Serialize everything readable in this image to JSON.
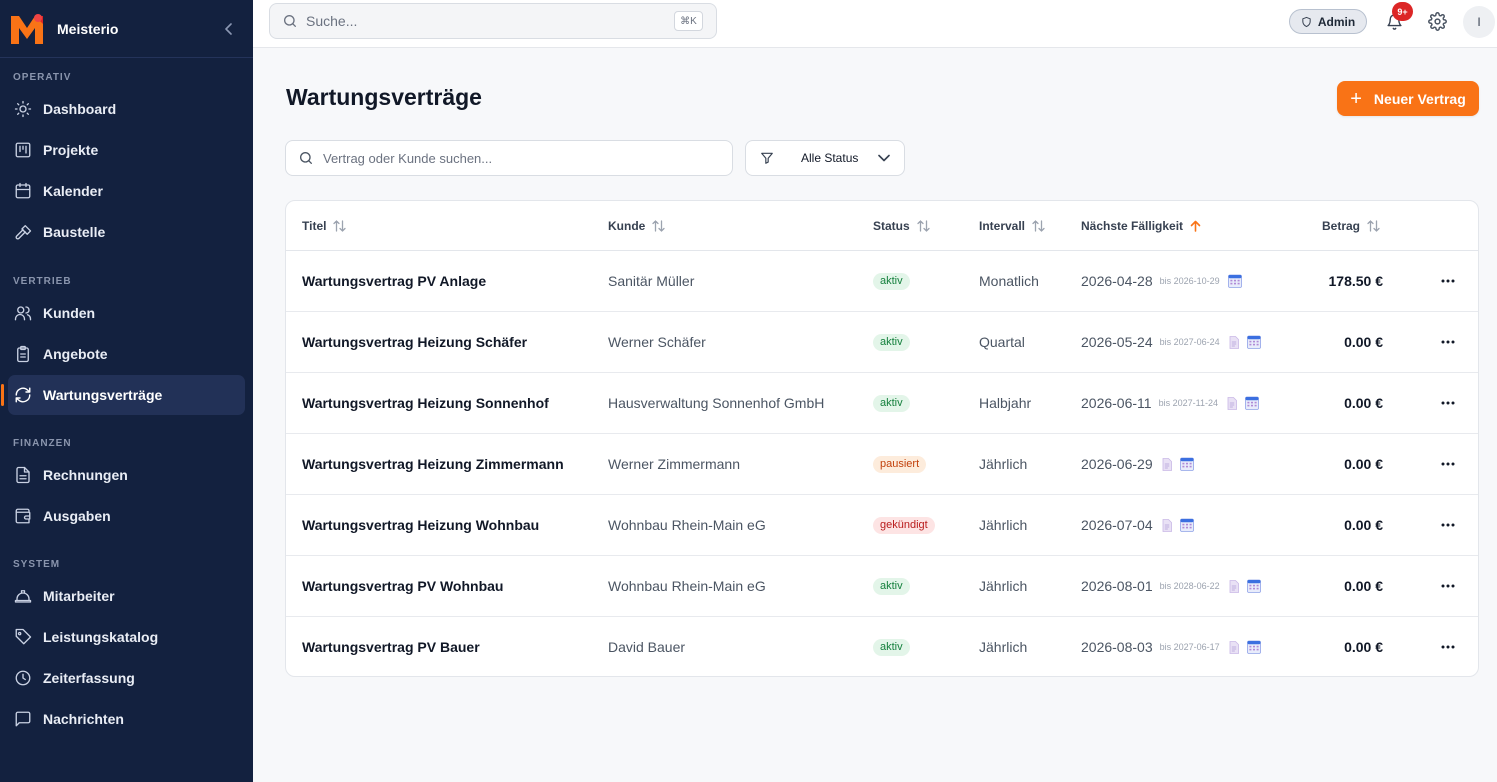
{
  "app": {
    "name": "Meisterio"
  },
  "sidebar": {
    "sections": [
      {
        "label": "OPERATIV",
        "items": [
          {
            "label": "Dashboard",
            "icon": "sun-icon"
          },
          {
            "label": "Projekte",
            "icon": "kanban-icon"
          },
          {
            "label": "Kalender",
            "icon": "calendar-icon"
          },
          {
            "label": "Baustelle",
            "icon": "hammer-icon"
          }
        ]
      },
      {
        "label": "VERTRIEB",
        "items": [
          {
            "label": "Kunden",
            "icon": "users-icon"
          },
          {
            "label": "Angebote",
            "icon": "clipboard-icon"
          },
          {
            "label": "Wartungsverträge",
            "icon": "refresh-icon",
            "active": true
          }
        ]
      },
      {
        "label": "FINANZEN",
        "items": [
          {
            "label": "Rechnungen",
            "icon": "file-text-icon"
          },
          {
            "label": "Ausgaben",
            "icon": "wallet-icon"
          }
        ]
      },
      {
        "label": "SYSTEM",
        "items": [
          {
            "label": "Mitarbeiter",
            "icon": "hardhat-icon"
          },
          {
            "label": "Leistungskatalog",
            "icon": "tag-icon"
          },
          {
            "label": "Zeiterfassung",
            "icon": "clock-icon"
          },
          {
            "label": "Nachrichten",
            "icon": "message-icon"
          }
        ]
      }
    ]
  },
  "topbar": {
    "search_placeholder": "Suche...",
    "shortcut": "⌘K",
    "role": "Admin",
    "notification_count": "9+",
    "avatar_initial": "I"
  },
  "page": {
    "title": "Wartungsverträge",
    "new_button": "Neuer Vertrag",
    "search_placeholder": "Vertrag oder Kunde suchen...",
    "status_filter": "Alle Status"
  },
  "table": {
    "columns": [
      {
        "label": "Titel"
      },
      {
        "label": "Kunde"
      },
      {
        "label": "Status"
      },
      {
        "label": "Intervall"
      },
      {
        "label": "Nächste Fälligkeit",
        "sorted": true
      },
      {
        "label": "Betrag"
      }
    ],
    "rows": [
      {
        "title": "Wartungsvertrag PV Anlage",
        "customer": "Sanitär Müller",
        "status": "aktiv",
        "status_kind": "aktiv",
        "interval": "Monatlich",
        "due": "2026-04-28",
        "until": "bis 2026-10-29",
        "has_doc": false,
        "amount": "178.50 €"
      },
      {
        "title": "Wartungsvertrag Heizung Schäfer",
        "customer": "Werner Schäfer",
        "status": "aktiv",
        "status_kind": "aktiv",
        "interval": "Quartal",
        "due": "2026-05-24",
        "until": "bis 2027-06-24",
        "has_doc": true,
        "amount": "0.00 €"
      },
      {
        "title": "Wartungsvertrag Heizung Sonnenhof",
        "customer": "Hausverwaltung Sonnenhof GmbH",
        "status": "aktiv",
        "status_kind": "aktiv",
        "interval": "Halbjahr",
        "due": "2026-06-11",
        "until": "bis 2027-11-24",
        "has_doc": true,
        "amount": "0.00 €"
      },
      {
        "title": "Wartungsvertrag Heizung Zimmermann",
        "customer": "Werner Zimmermann",
        "status": "pausiert",
        "status_kind": "pausiert",
        "interval": "Jährlich",
        "due": "2026-06-29",
        "until": "",
        "has_doc": true,
        "amount": "0.00 €"
      },
      {
        "title": "Wartungsvertrag Heizung Wohnbau",
        "customer": "Wohnbau Rhein-Main eG",
        "status": "gekündigt",
        "status_kind": "gekuendigt",
        "interval": "Jährlich",
        "due": "2026-07-04",
        "until": "",
        "has_doc": true,
        "amount": "0.00 €"
      },
      {
        "title": "Wartungsvertrag PV Wohnbau",
        "customer": "Wohnbau Rhein-Main eG",
        "status": "aktiv",
        "status_kind": "aktiv",
        "interval": "Jährlich",
        "due": "2026-08-01",
        "until": "bis 2028-06-22",
        "has_doc": true,
        "amount": "0.00 €"
      },
      {
        "title": "Wartungsvertrag PV Bauer",
        "customer": "David Bauer",
        "status": "aktiv",
        "status_kind": "aktiv",
        "interval": "Jährlich",
        "due": "2026-08-03",
        "until": "bis 2027-06-17",
        "has_doc": true,
        "amount": "0.00 €"
      }
    ]
  },
  "colors": {
    "sidebar_bg": "#13213f",
    "accent": "#f97316",
    "badge_red": "#dc2626"
  }
}
